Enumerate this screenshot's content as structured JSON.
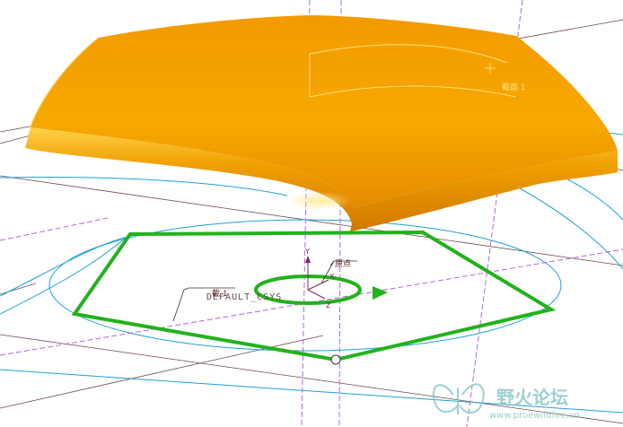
{
  "viewport": {
    "labels": {
      "section_top": "截面 1",
      "origin": "原点",
      "section_left": "截 1",
      "csys": "DEFAULT_CSYS",
      "axis_y": "Y",
      "axis_x": "X",
      "axis_z": "Z"
    },
    "watermark": {
      "title": "野火论坛",
      "url": "www.proewildfire.cn"
    },
    "colors": {
      "surface": "#f5a000",
      "sketch": "#22b21c",
      "datum_curve": "#1ea0d8",
      "datum_plane": "#6b4a4a",
      "axis": "#b06ad8"
    },
    "icons": {
      "watermark_logo": "butterfly-logo-icon",
      "direction": "arrow-right-icon",
      "vertex": "vertex-point-icon"
    }
  }
}
